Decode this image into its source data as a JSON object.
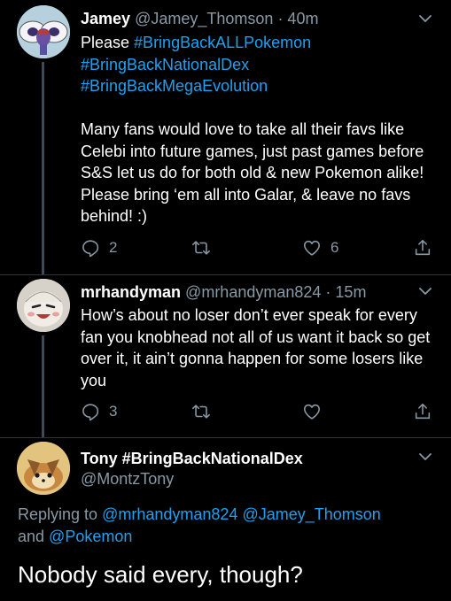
{
  "tweets": [
    {
      "name": "Jamey",
      "handle": "@Jamey_Thomson",
      "time": "· 40m",
      "body": [
        {
          "text": "Please ",
          "link": false
        },
        {
          "text": "#BringBackALLPokemon",
          "link": true
        },
        {
          "text": "\n",
          "link": false
        },
        {
          "text": "#BringBackNationalDex",
          "link": true
        },
        {
          "text": "\n",
          "link": false
        },
        {
          "text": "#BringBackMegaEvolution",
          "link": true
        },
        {
          "text": "\n\nMany fans would love to take all their favs like Celebi into future games, just past games before S&S let us do for both old & new Pokemon alike! Please bring ‘em all into Galar, & leave no favs behind! :)",
          "link": false
        }
      ],
      "replies": "2",
      "retweets": "",
      "likes": "6"
    },
    {
      "name": "mrhandyman",
      "handle": "@mrhandyman824",
      "time": "· 15m",
      "body": [
        {
          "text": "How’s about no loser don’t ever speak for every fan you knobhead  not all of us want it back so get over it, it ain’t gonna happen for some losers like you",
          "link": false
        }
      ],
      "replies": "3",
      "retweets": "",
      "likes": ""
    }
  ],
  "main_tweet": {
    "name": "Tony #BringBackNationalDex",
    "handle": "@MontzTony",
    "replying_prefix": "Replying to ",
    "replying_to": [
      "@mrhandyman824",
      "@Jamey_Thomson",
      "@Pokemon"
    ],
    "replying_join": " ",
    "replying_and": "and ",
    "text": "Nobody said every, though?"
  },
  "colors": {
    "background": "#000000",
    "link": "#1da1f2",
    "muted": "#8899a6",
    "thread_line": "#3d4a56"
  },
  "icons": [
    "reply-icon",
    "retweet-icon",
    "like-icon",
    "share-icon",
    "chevron-down-icon"
  ]
}
